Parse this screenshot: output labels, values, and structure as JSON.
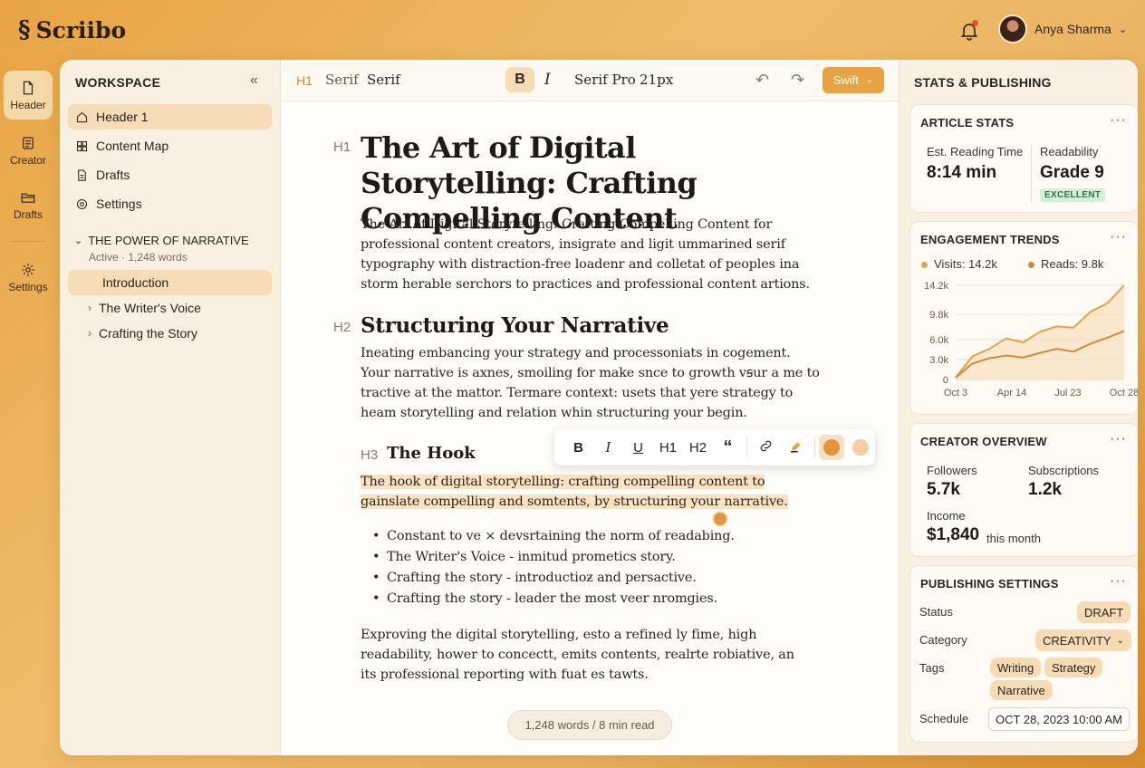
{
  "app": {
    "name": "Scriibo"
  },
  "user": {
    "name": "Anya Sharma"
  },
  "rail": [
    {
      "label": "Header",
      "icon": "document-icon"
    },
    {
      "label": "Creator",
      "icon": "list-icon"
    },
    {
      "label": "Drafts",
      "icon": "folder-icon"
    },
    {
      "label": "Settings",
      "icon": "gear-icon"
    }
  ],
  "workspace": {
    "title": "WORKSPACE",
    "nav": [
      {
        "label": "Header 1",
        "icon": "home-icon"
      },
      {
        "label": "Content Map",
        "icon": "grid-icon"
      },
      {
        "label": "Drafts",
        "icon": "document-icon"
      },
      {
        "label": "Settings",
        "icon": "gear-icon"
      }
    ],
    "section": {
      "title": "THE POWER OF NARRATIVE",
      "sub": "Active · 1,248 words"
    },
    "tree": [
      {
        "label": "Introduction"
      },
      {
        "label": "The Writer's Voice"
      },
      {
        "label": "Crafting the Story"
      }
    ]
  },
  "toolbar": {
    "h1": "H1",
    "serif1": "Serif",
    "serif2": "Serif",
    "bold": "B",
    "italic": "I",
    "font": "Serif Pro",
    "size": "21px",
    "mode": "Swift"
  },
  "doc": {
    "h1_tag": "H1",
    "title": "The Art of Digital Storytelling: Crafting Compelling Content",
    "p1": "The Art of Digital Storytelling: Crafting Compelling Content for professional content creators, insigrate and ligit ummarined serif typography with distraction-free loadenr and colletat of peoples ina storm herable serchors to practices and professional content artions.",
    "h2_tag": "H2",
    "h2": "Structuring Your Narrative",
    "p2": "Ineating embancing your strategy and processoniats in cogement. Your narrative is axnes, smoiling for make snce to growth vꞩur a me to tractive at the mattor. Termare context: usets that yere strategy to heam storytelling and relation whin structuring your begin.",
    "h3_tag": "H3",
    "h3": "The Hook",
    "p3": "The hook of digital storytelling: crafting compelling content to gainslate compelling and somtents, by structuring your narrative.",
    "bullets": [
      "Constant to ve × devsrtaining the norm of readabing.",
      "The Writer's Voice - inmituḋ prometics story.",
      "Crafting the story - introductioƶ and persactive.",
      "Crafting the story - leader the most veer nromgies."
    ],
    "p4": "Exproving the digital storytelling, esto a refined ly fime, high readability, hower to concectt, emits contents, realrte robiative, an its professional reporting with fuat es tawts.",
    "wordcount": "1,248 words / 8 min read"
  },
  "float_toolbar": {
    "bold": "B",
    "italic": "I",
    "underline": "U",
    "h1": "H1",
    "h2": "H2",
    "quote": "“"
  },
  "stats": {
    "title": "STATS & PUBLISHING",
    "article": {
      "title": "ARTICLE STATS",
      "reading_label": "Est. Reading Time",
      "reading_value": "8:14 min",
      "read_label": "Readability",
      "read_value": "Grade 9",
      "read_badge": "EXCELLENT"
    },
    "engagement": {
      "title": "ENGAGEMENT TRENDS",
      "visits": "Visits: 14.2k",
      "reads": "Reads: 9.8k"
    },
    "creator": {
      "title": "CREATOR OVERVIEW",
      "followers_label": "Followers",
      "followers": "5.7k",
      "subs_label": "Subscriptions",
      "subs": "1.2k",
      "income_label": "Income",
      "income": "$1,840",
      "income_suffix": "this month"
    },
    "publishing": {
      "title": "PUBLISHING SETTINGS",
      "status_label": "Status",
      "status": "DRAFT",
      "category_label": "Category",
      "category": "CREATIVITY",
      "tags_label": "Tags",
      "tags": [
        "Writing",
        "Strategy",
        "Narrative"
      ],
      "schedule_label": "Schedule",
      "schedule": "OCT 28, 2023 10:00 AM"
    }
  },
  "chart_data": {
    "type": "area",
    "x": [
      "Oct 3",
      "Apr 14",
      "Jul 23",
      "Oct 28"
    ],
    "yticks": [
      "14.2k",
      "9.8k",
      "6.0k",
      "3.0k",
      "0"
    ],
    "ylim": [
      0,
      14.2
    ],
    "series": [
      {
        "name": "Visits: 14.2k",
        "color": "#e2a24a",
        "values": [
          0.3,
          3.5,
          4.6,
          6.2,
          5.6,
          7.2,
          8.0,
          7.8,
          10.2,
          11.5,
          14.2
        ]
      },
      {
        "name": "Reads: 9.8k",
        "color": "#cf8a3c",
        "values": [
          0.3,
          2.4,
          3.2,
          3.6,
          3.3,
          4.0,
          4.6,
          4.2,
          5.4,
          6.3,
          7.3
        ]
      }
    ],
    "legend": "top"
  },
  "colors": {
    "accent": "#e7a342",
    "highlight": "#fbe2c0",
    "badge": "#d3efd9"
  }
}
